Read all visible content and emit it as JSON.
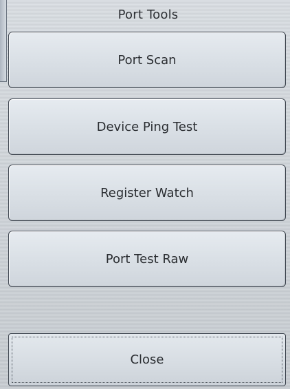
{
  "dialog": {
    "title": "Port Tools"
  },
  "menu": {
    "items": [
      {
        "label": "Port Scan"
      },
      {
        "label": "Device Ping Test"
      },
      {
        "label": "Register Watch"
      },
      {
        "label": "Port Test Raw"
      }
    ]
  },
  "footer": {
    "close_label": "Close"
  }
}
